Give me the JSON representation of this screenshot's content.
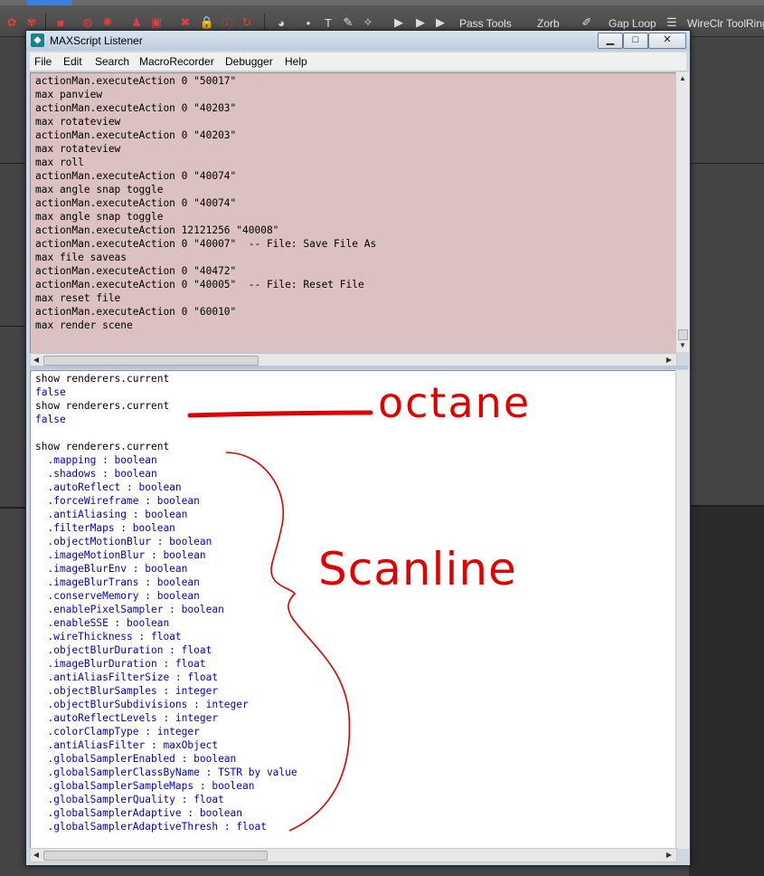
{
  "toolbar": {
    "items": [
      "Pass Tools",
      "Zorb",
      "Gap Loop",
      "WireClr Tool",
      "Ring"
    ]
  },
  "window": {
    "title": "MAXScript Listener",
    "controls": {
      "minimize": "▁",
      "maximize": "□",
      "close": "✕"
    }
  },
  "menu": [
    "File",
    "Edit",
    "Search",
    "MacroRecorder",
    "Debugger",
    "Help"
  ],
  "macro_lines": [
    "actionMan.executeAction 0 \"50017\"",
    "max panview",
    "actionMan.executeAction 0 \"40203\"",
    "max rotateview",
    "actionMan.executeAction 0 \"40203\"",
    "max rotateview",
    "max roll",
    "actionMan.executeAction 0 \"40074\"",
    "max angle snap toggle",
    "actionMan.executeAction 0 \"40074\"",
    "max angle snap toggle",
    "actionMan.executeAction 12121256 \"40008\"",
    "actionMan.executeAction 0 \"40007\"  -- File: Save File As",
    "max file saveas",
    "actionMan.executeAction 0 \"40472\"",
    "actionMan.executeAction 0 \"40005\"  -- File: Reset File",
    "max reset file",
    "actionMan.executeAction 0 \"60010\"",
    "max render scene"
  ],
  "output_lines": [
    {
      "text": "show renderers.current",
      "result": false
    },
    {
      "text": "false",
      "result": true
    },
    {
      "text": "show renderers.current",
      "result": false
    },
    {
      "text": "false",
      "result": true
    },
    {
      "text": "",
      "result": false
    },
    {
      "text": "show renderers.current",
      "result": false
    },
    {
      "text": "  .mapping : boolean",
      "result": true
    },
    {
      "text": "  .shadows : boolean",
      "result": true
    },
    {
      "text": "  .autoReflect : boolean",
      "result": true
    },
    {
      "text": "  .forceWireframe : boolean",
      "result": true
    },
    {
      "text": "  .antiAliasing : boolean",
      "result": true
    },
    {
      "text": "  .filterMaps : boolean",
      "result": true
    },
    {
      "text": "  .objectMotionBlur : boolean",
      "result": true
    },
    {
      "text": "  .imageMotionBlur : boolean",
      "result": true
    },
    {
      "text": "  .imageBlurEnv : boolean",
      "result": true
    },
    {
      "text": "  .imageBlurTrans : boolean",
      "result": true
    },
    {
      "text": "  .conserveMemory : boolean",
      "result": true
    },
    {
      "text": "  .enablePixelSampler : boolean",
      "result": true
    },
    {
      "text": "  .enableSSE : boolean",
      "result": true
    },
    {
      "text": "  .wireThickness : float",
      "result": true
    },
    {
      "text": "  .objectBlurDuration : float",
      "result": true
    },
    {
      "text": "  .imageBlurDuration : float",
      "result": true
    },
    {
      "text": "  .antiAliasFilterSize : float",
      "result": true
    },
    {
      "text": "  .objectBlurSamples : integer",
      "result": true
    },
    {
      "text": "  .objectBlurSubdivisions : integer",
      "result": true
    },
    {
      "text": "  .autoReflectLevels : integer",
      "result": true
    },
    {
      "text": "  .colorClampType : integer",
      "result": true
    },
    {
      "text": "  .antiAliasFilter : maxObject",
      "result": true
    },
    {
      "text": "  .globalSamplerEnabled : boolean",
      "result": true
    },
    {
      "text": "  .globalSamplerClassByName : TSTR by value",
      "result": true
    },
    {
      "text": "  .globalSamplerSampleMaps : boolean",
      "result": true
    },
    {
      "text": "  .globalSamplerQuality : float",
      "result": true
    },
    {
      "text": "  .globalSamplerAdaptive : boolean",
      "result": true
    },
    {
      "text": "  .globalSamplerAdaptiveThresh : float",
      "result": true
    }
  ],
  "annotations": {
    "octane": "octane",
    "scanline": "Scanline",
    "color": "#e00000"
  }
}
